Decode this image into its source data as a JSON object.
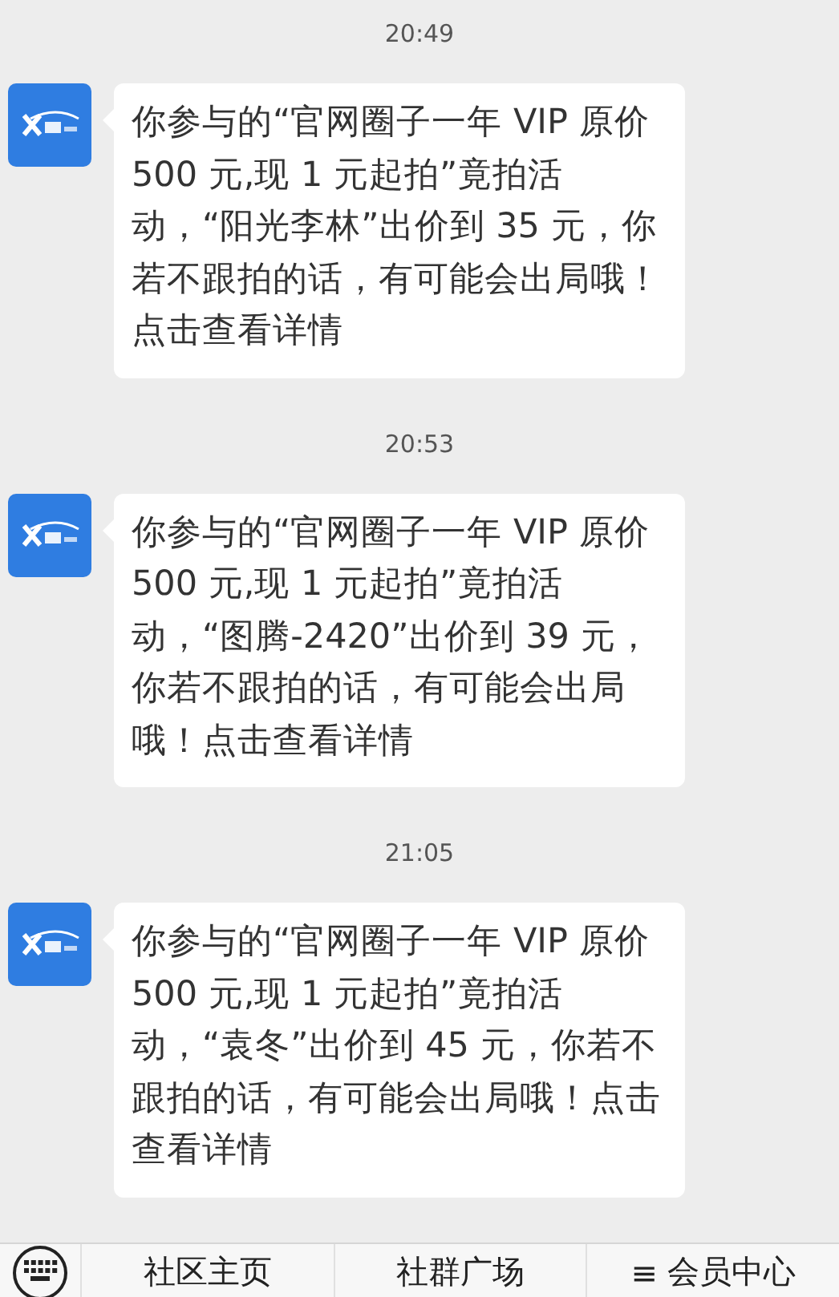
{
  "messages": [
    {
      "time": "20:49",
      "text": "你参与的“官网圈子一年 VIP 原价 500 元,现 1 元起拍”竟拍活动，“阳光李林”出价到 35 元，你若不跟拍的话，有可能会出局哦！点击查看详情"
    },
    {
      "time": "20:53",
      "text": "你参与的“官网圈子一年 VIP 原价 500 元,现 1 元起拍”竟拍活动，“图腾-2420”出价到 39 元，你若不跟拍的话，有可能会出局哦！点击查看详情"
    },
    {
      "time": "21:05",
      "text": "你参与的“官网圈子一年 VIP 原价 500 元,现 1 元起拍”竟拍活动，“袁冬”出价到 45 元，你若不跟拍的话，有可能会出局哦！点击查看详情"
    }
  ],
  "menu": [
    {
      "label": "社区主页",
      "kind": "plain"
    },
    {
      "label": "社群广场",
      "kind": "plain"
    },
    {
      "label": "会员中心",
      "kind": "submenu"
    }
  ],
  "menu_glyph": "≡"
}
